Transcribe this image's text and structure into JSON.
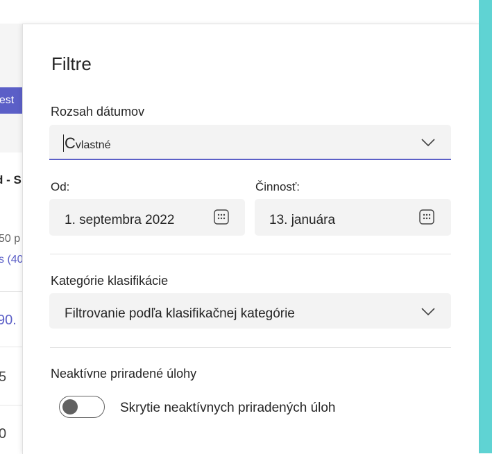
{
  "background": {
    "button_fragment": "nest",
    "card_texts": [
      "d - S",
      "50 p",
      "s (40",
      "90.",
      "5",
      "0"
    ]
  },
  "panel": {
    "title": "Filtre",
    "date_range": {
      "label": "Rozsah dátumov",
      "value_prefix": "C",
      "value_rest": "vlastné"
    },
    "from": {
      "label": "Od:",
      "value": "1. septembra 2022"
    },
    "to": {
      "label": "Činnosť:",
      "value": "13. januára"
    },
    "category": {
      "label": "Kategórie klasifikácie",
      "value": "Filtrovanie podľa klasifikačnej kategórie"
    },
    "inactive": {
      "label": "Neaktívne priradené úlohy",
      "toggle_label": "Skrytie neaktívnych priradených úloh",
      "toggle_on": false
    }
  },
  "colors": {
    "accent": "#5b5fc7",
    "teal": "#5fd3d3"
  },
  "icons": [
    "chevron-down-icon",
    "calendar-icon",
    "toggle-knob"
  ]
}
